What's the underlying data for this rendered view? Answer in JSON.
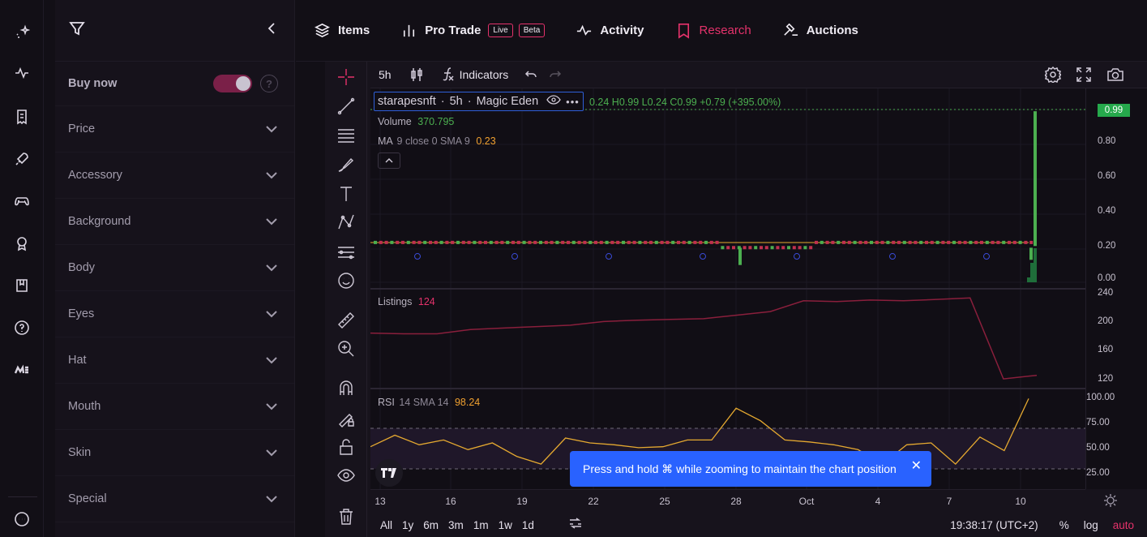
{
  "rail": {
    "icons": [
      "sparkle-logo-icon",
      "pulse-icon",
      "receipt-icon",
      "rocket-icon",
      "gamepad-icon",
      "award-icon",
      "book-icon",
      "help-icon",
      "magic-eden-icon",
      "more-icon"
    ]
  },
  "filters": {
    "buy_now_label": "Buy now",
    "help_glyph": "?",
    "categories": [
      "Price",
      "Accessory",
      "Background",
      "Body",
      "Eyes",
      "Hat",
      "Mouth",
      "Skin",
      "Special"
    ]
  },
  "nav": {
    "items": "Items",
    "pro_trade": "Pro Trade",
    "live_badge": "Live",
    "beta_badge": "Beta",
    "activity": "Activity",
    "research": "Research",
    "auctions": "Auctions"
  },
  "toolbar": {
    "interval": "5h",
    "indicators": "Indicators"
  },
  "legend": {
    "symbol": "starapesnft",
    "sep1": "·",
    "interval": "5h",
    "sep2": "·",
    "exchange": "Magic Eden",
    "ohlc": "0.24 H0.99 L0.24 C0.99 +0.79 (+395.00%)",
    "volume_label": "Volume",
    "volume_value": "370.795",
    "ma_label": "MA",
    "ma_params": "9 close 0 SMA 9",
    "ma_value": "0.23",
    "listings_label": "Listings",
    "listings_value": "124",
    "rsi_label": "RSI",
    "rsi_params": "14 SMA 14",
    "rsi_value": "98.24"
  },
  "price_axis": {
    "last": "0.99",
    "main_ticks": [
      "0.80",
      "0.60",
      "0.40",
      "0.20",
      "0.00"
    ],
    "listings_ticks": [
      "240",
      "200",
      "160",
      "120"
    ],
    "rsi_ticks": [
      "100.00",
      "75.00",
      "50.00",
      "25.00"
    ]
  },
  "time_axis": [
    "13",
    "16",
    "19",
    "22",
    "25",
    "28",
    "Oct",
    "4",
    "7",
    "10"
  ],
  "bottom": {
    "ranges": [
      "All",
      "1y",
      "6m",
      "3m",
      "1m",
      "1w",
      "1d"
    ],
    "clock": "19:38:17 (UTC+2)",
    "percent": "%",
    "log": "log",
    "auto": "auto"
  },
  "toast": {
    "message": "Press and hold ⌘ while zooming to maintain the chart position",
    "close": "✕"
  },
  "chart_data": {
    "type": "line",
    "series": [
      {
        "name": "Listings",
        "values": [
          185,
          184,
          184,
          190,
          192,
          194,
          196,
          201,
          203,
          204,
          205,
          210,
          215,
          230,
          229,
          231,
          230,
          232,
          234,
          121,
          126
        ]
      },
      {
        "name": "RSI",
        "values": [
          48,
          60,
          50,
          55,
          45,
          52,
          38,
          30,
          57,
          52,
          50,
          47,
          48,
          55,
          55,
          88,
          75,
          55,
          53,
          50,
          45,
          30,
          50,
          52,
          30,
          58,
          44,
          98
        ]
      }
    ],
    "price": {
      "last": 0.99,
      "baseline": 0.23,
      "ylim": [
        0,
        1.0
      ]
    }
  }
}
